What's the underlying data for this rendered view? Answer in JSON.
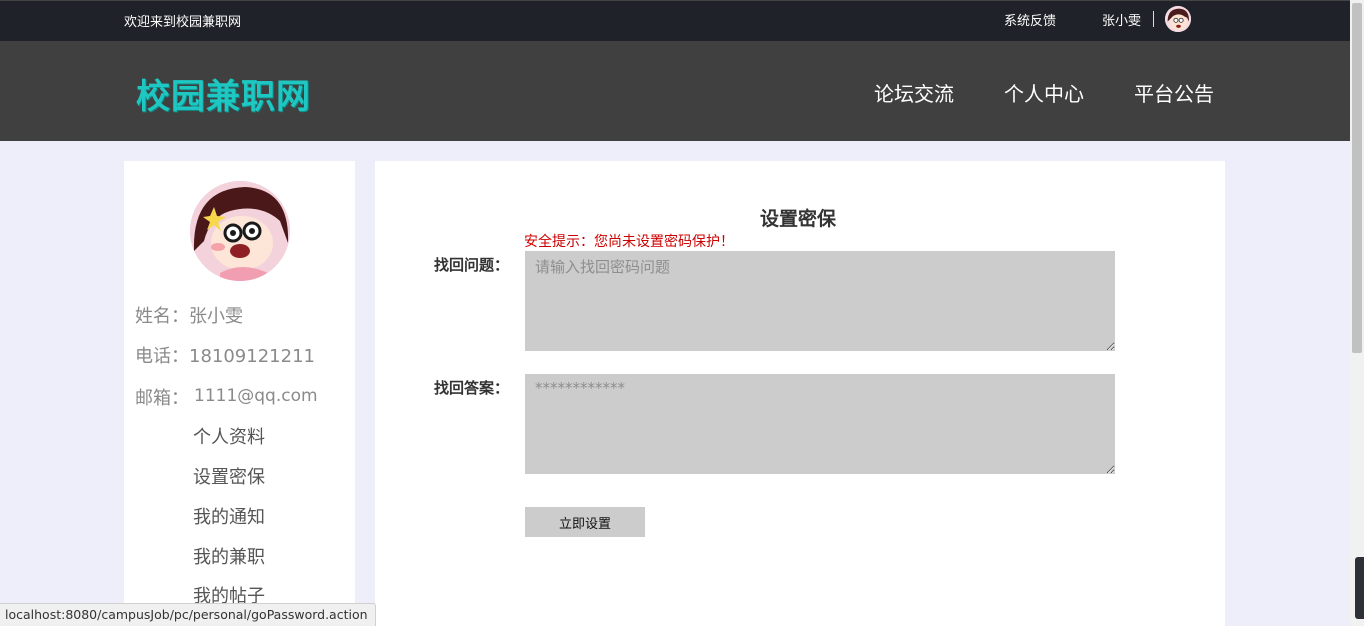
{
  "topbar": {
    "welcome": "欢迎来到校园兼职网",
    "feedback": "系统反馈",
    "username": "张小雯"
  },
  "header": {
    "logo": "校园兼职网",
    "nav": [
      "论坛交流",
      "个人中心",
      "平台公告"
    ]
  },
  "sidebar": {
    "name_label": "姓名：",
    "name": "张小雯",
    "phone_label": "电话：",
    "phone": "18109121211",
    "email_label": "邮箱：",
    "email": "1111@qq.com",
    "links": [
      "个人资料",
      "设置密保",
      "我的通知",
      "我的兼职",
      "我的帖子"
    ]
  },
  "form": {
    "title": "设置密保",
    "warning": "安全提示：您尚未设置密码保护！",
    "question_label": "找回问题：",
    "question_placeholder": "请输入找回密码问题",
    "answer_label": "找回答案：",
    "answer_placeholder": "************",
    "submit_label": "立即设置"
  },
  "statusbar": {
    "url": "localhost:8080/campusJob/pc/personal/goPassword.action"
  },
  "colors": {
    "logo": "#1fc7c2",
    "warning": "#cc0000",
    "header_bg": "#404040",
    "topbar_bg": "#1f2228",
    "page_bg": "#eeeefb"
  }
}
